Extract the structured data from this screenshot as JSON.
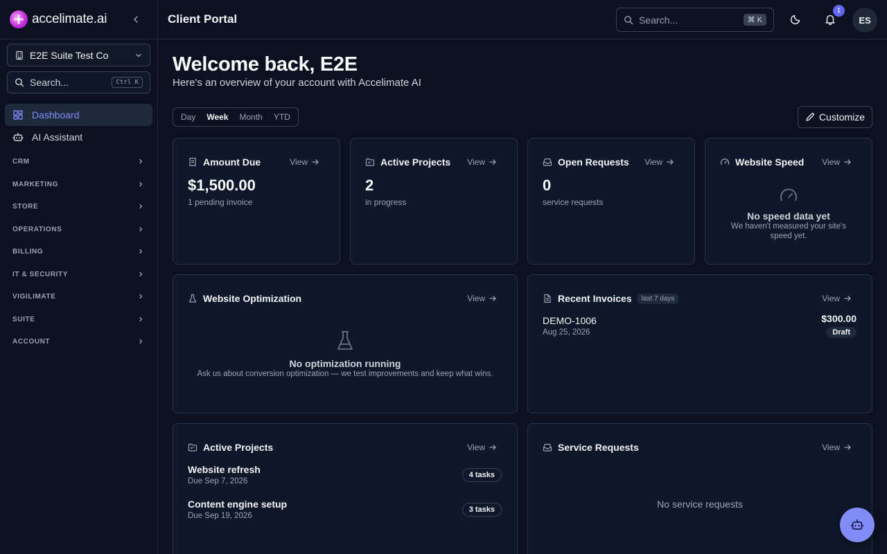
{
  "brand": {
    "name": "accelimate.ai",
    "logo_icon": "brand-logo-icon"
  },
  "sidebar": {
    "org": "E2E Suite Test Co",
    "search_placeholder": "Search...",
    "search_shortcut": "Ctrl K",
    "nav": [
      {
        "label": "Dashboard",
        "icon": "dashboard-icon",
        "active": true
      },
      {
        "label": "AI Assistant",
        "icon": "bot-icon",
        "active": false
      }
    ],
    "groups": [
      "CRM",
      "MARKETING",
      "STORE",
      "OPERATIONS",
      "BILLING",
      "IT & SECURITY",
      "VIGILIMATE",
      "SUITE",
      "ACCOUNT"
    ]
  },
  "topbar": {
    "title": "Client Portal",
    "search_placeholder": "Search...",
    "search_shortcut": "⌘ K",
    "notification_count": "1",
    "avatar_initials": "ES"
  },
  "header": {
    "welcome": "Welcome back, E2E",
    "subtitle": "Here's an overview of your account with Accelimate AI",
    "ranges": [
      "Day",
      "Week",
      "Month",
      "YTD"
    ],
    "selected_range": "Week",
    "customize_label": "Customize"
  },
  "view_label": "View",
  "cards": {
    "amount_due": {
      "title": "Amount Due",
      "value": "$1,500.00",
      "note": "1 pending invoice"
    },
    "active_projects": {
      "title": "Active Projects",
      "value": "2",
      "note": "in progress"
    },
    "open_requests": {
      "title": "Open Requests",
      "value": "0",
      "note": "service requests"
    },
    "website_speed": {
      "title": "Website Speed",
      "empty_title": "No speed data yet",
      "empty_desc": "We haven't measured your site's speed yet."
    },
    "website_optimization": {
      "title": "Website Optimization",
      "empty_title": "No optimization running",
      "empty_desc": "Ask us about conversion optimization — we test improvements and keep what wins."
    },
    "recent_invoices": {
      "title": "Recent Invoices",
      "badge": "last 7 days",
      "items": [
        {
          "number": "DEMO-1006",
          "date": "Aug 25, 2026",
          "amount": "$300.00",
          "status": "Draft"
        }
      ]
    },
    "projects_list": {
      "title": "Active Projects",
      "items": [
        {
          "name": "Website refresh",
          "due": "Due Sep 7, 2026",
          "tasks": "4 tasks"
        },
        {
          "name": "Content engine setup",
          "due": "Due Sep 19, 2026",
          "tasks": "3 tasks"
        }
      ]
    },
    "service_requests": {
      "title": "Service Requests",
      "empty": "No service requests"
    }
  },
  "colors": {
    "accent": "#818cf8",
    "background": "#0b1120",
    "card": "#0f172a",
    "border": "#273244"
  }
}
